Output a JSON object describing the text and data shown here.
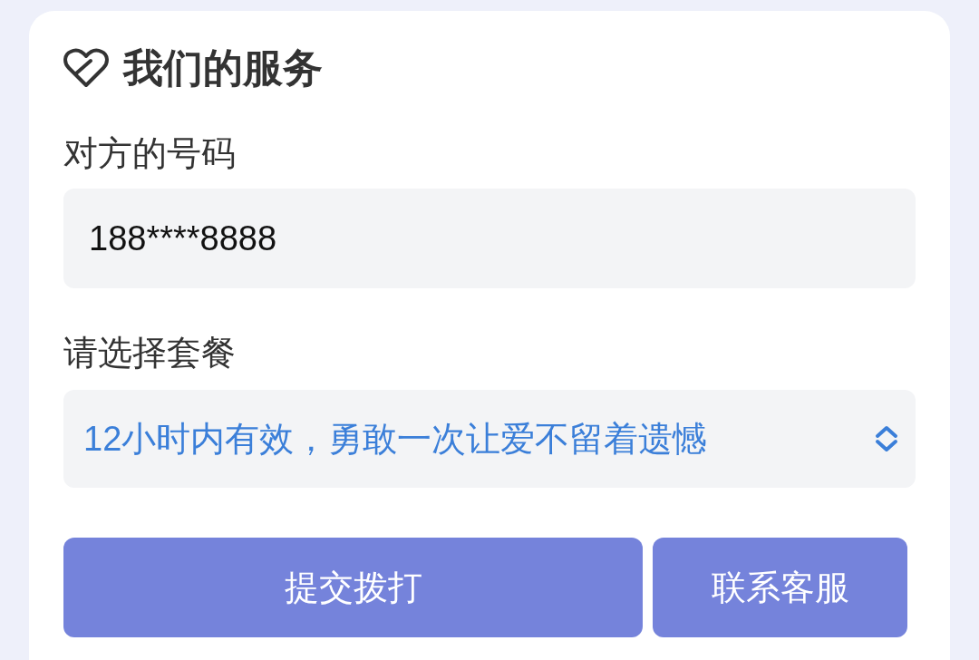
{
  "card": {
    "title": "我们的服务",
    "fields": [
      {
        "kind": "input",
        "label": "对方的号码",
        "value": "188****8888"
      },
      {
        "kind": "select",
        "label": "请选择套餐",
        "value": "12小时内有效，勇敢一次让爱不留着遗憾"
      }
    ],
    "buttons": [
      {
        "label": "提交拨打"
      },
      {
        "label": "联系客服"
      }
    ]
  }
}
